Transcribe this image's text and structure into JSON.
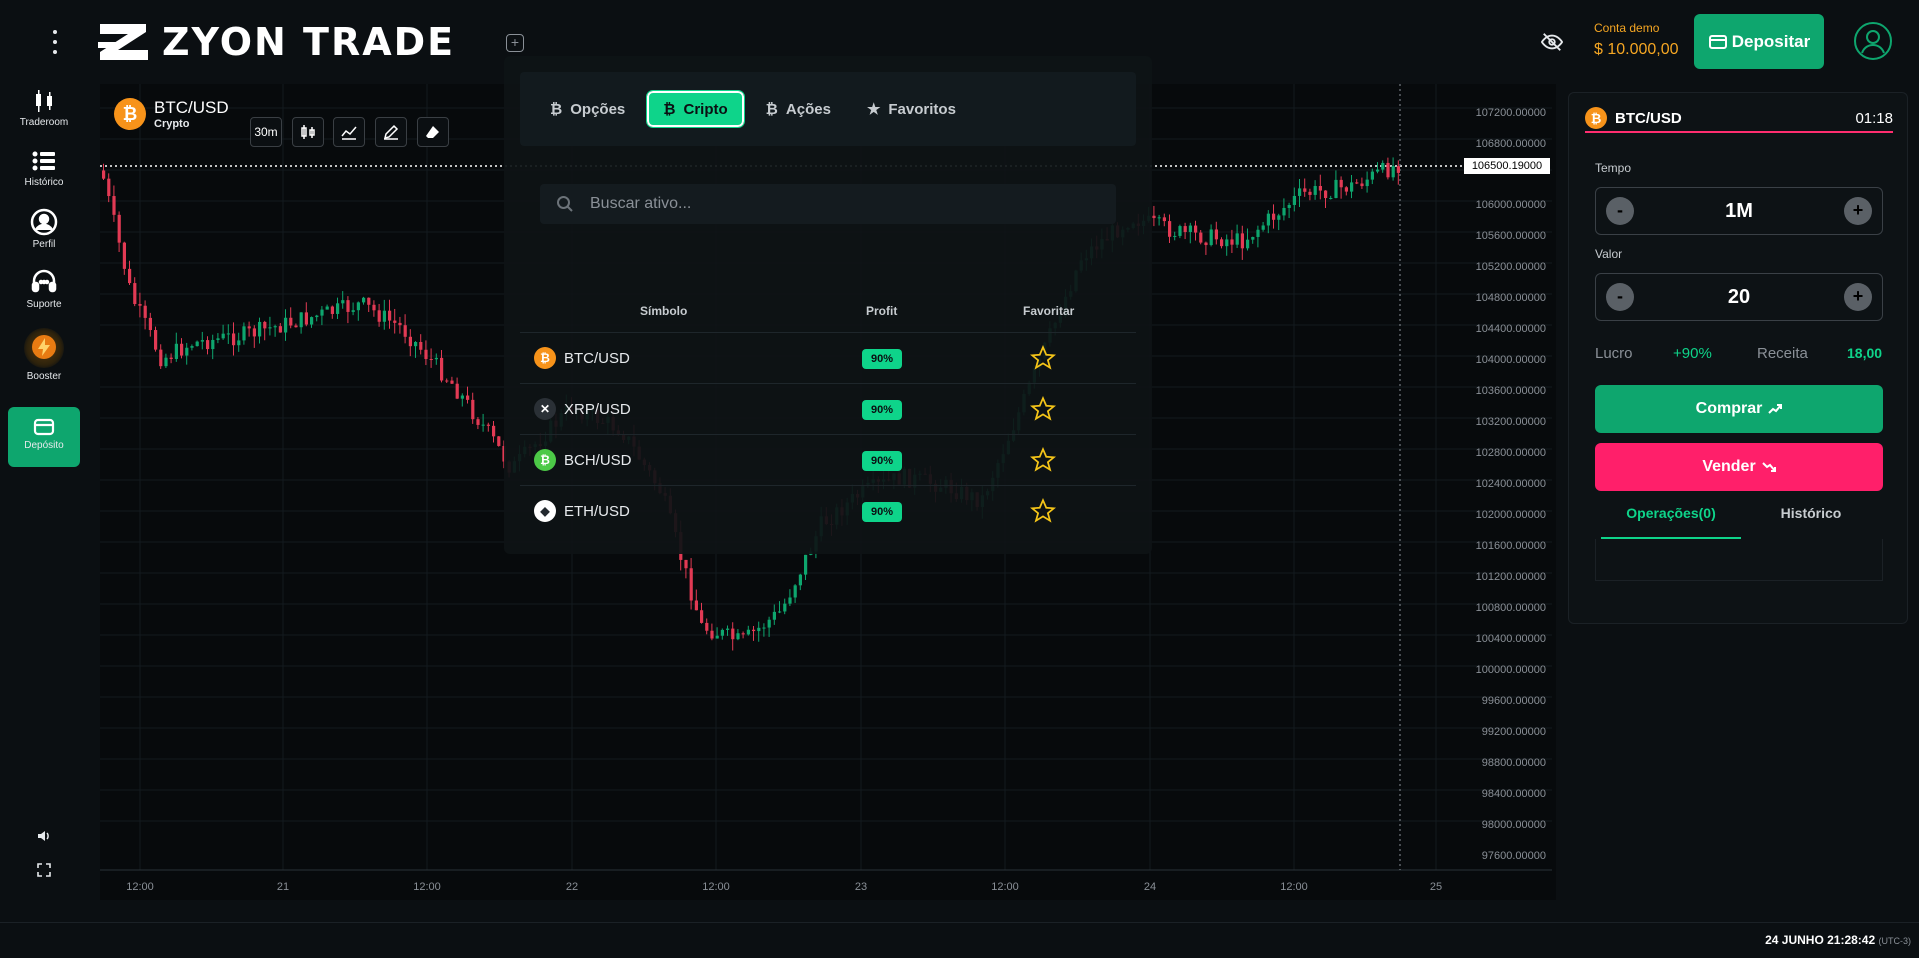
{
  "header": {
    "logo_text": "ZYON TRADE",
    "demo_label": "Conta demo",
    "demo_balance": "$ 10.000,00",
    "deposit_label": "Depositar"
  },
  "sidebar": {
    "items": [
      {
        "label": "Traderoom",
        "icon": "candles-icon"
      },
      {
        "label": "Histórico",
        "icon": "list-icon"
      },
      {
        "label": "Perfil",
        "icon": "user-icon"
      },
      {
        "label": "Suporte",
        "icon": "headset-icon"
      },
      {
        "label": "Booster",
        "icon": "bolt-icon"
      },
      {
        "label": "Depósito",
        "icon": "wallet-icon"
      }
    ]
  },
  "chart": {
    "asset": "BTC/USD",
    "asset_type": "Crypto",
    "timeframe": "30m",
    "current_price": "106500.19000",
    "y_ticks": [
      "107200.00000",
      "106800.00000",
      "106000.00000",
      "105600.00000",
      "105200.00000",
      "104800.00000",
      "104400.00000",
      "104000.00000",
      "103600.00000",
      "103200.00000",
      "102800.00000",
      "102400.00000",
      "102000.00000",
      "101600.00000",
      "101200.00000",
      "100800.00000",
      "100400.00000",
      "100000.00000",
      "99600.00000",
      "99200.00000",
      "98800.00000",
      "98400.00000",
      "98000.00000",
      "97600.00000"
    ],
    "x_ticks": [
      "12:00",
      "21",
      "12:00",
      "22",
      "12:00",
      "23",
      "12:00",
      "24",
      "12:00",
      "25"
    ]
  },
  "chart_data": {
    "type": "candlestick",
    "title": "",
    "xlabel": "",
    "ylabel": "",
    "ylim": [
      97400,
      107400
    ],
    "up_color": "#0ea66e",
    "down_color": "#e23a54",
    "current_price": 106500.19
  },
  "dropdown": {
    "tabs": [
      {
        "label": "Opções",
        "active": false,
        "icon": "bitcoin-icon"
      },
      {
        "label": "Cripto",
        "active": true,
        "icon": "bitcoin-icon"
      },
      {
        "label": "Ações",
        "active": false,
        "icon": "bitcoin-icon"
      },
      {
        "label": "Favoritos",
        "active": false,
        "icon": "star-icon"
      }
    ],
    "search_placeholder": "Buscar ativo...",
    "columns": [
      "Símbolo",
      "Profit",
      "Favoritar"
    ],
    "rows": [
      {
        "symbol": "BTC/USD",
        "profit": "90%",
        "coin_color": "#f7931a",
        "coin_glyph": "₿"
      },
      {
        "symbol": "XRP/USD",
        "profit": "90%",
        "coin_color": "#23292f",
        "coin_glyph": "✕"
      },
      {
        "symbol": "BCH/USD",
        "profit": "90%",
        "coin_color": "#4cc947",
        "coin_glyph": "₿"
      },
      {
        "symbol": "ETH/USD",
        "profit": "90%",
        "coin_color": "#ffffff",
        "coin_glyph": "◆"
      }
    ]
  },
  "trade_panel": {
    "asset": "BTC/USD",
    "countdown": "01:18",
    "time_label": "Tempo",
    "time_value": "1M",
    "value_label": "Valor",
    "value_amount": "20",
    "minus": "-",
    "plus": "+",
    "profit_label": "Lucro",
    "profit_value": "+90%",
    "revenue_label": "Receita",
    "revenue_value": "18,00",
    "buy_label": "Comprar",
    "sell_label": "Vender",
    "tab_operations": "Operações(0)",
    "tab_history": "Histórico"
  },
  "status": {
    "datetime": "24 JUNHO 21:28:42",
    "timezone": "(UTC-3)"
  }
}
